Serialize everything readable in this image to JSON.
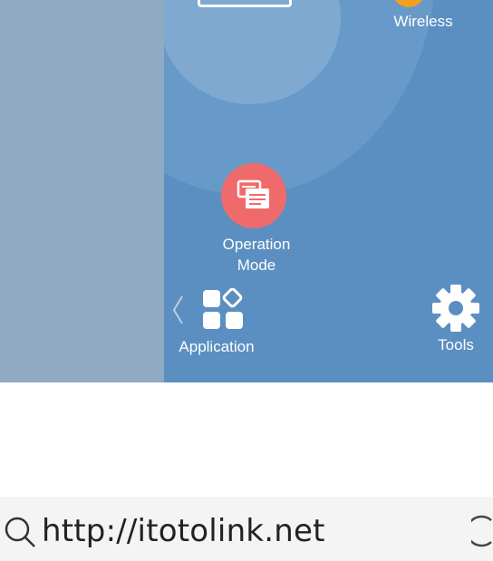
{
  "menu": {
    "wireless_label": "Wireless",
    "operation_mode_label": "Operation\nMode",
    "application_label": "Application",
    "tools_label": "Tools"
  },
  "browser": {
    "url": "http://itotolink.net"
  },
  "icons": {
    "operation_mode": "operation-mode-icon",
    "application": "application-grid-icon",
    "tools": "gear-icon",
    "prev": "chevron-left-icon",
    "search": "search-icon",
    "reload": "reload-icon"
  },
  "colors": {
    "panel": "#5b8fc1",
    "left_strip": "#8faac2",
    "operation_mode_accent": "#ef6b6b",
    "wireless_accent": "#f0a11e",
    "url_bar": "#f4f4f4"
  }
}
